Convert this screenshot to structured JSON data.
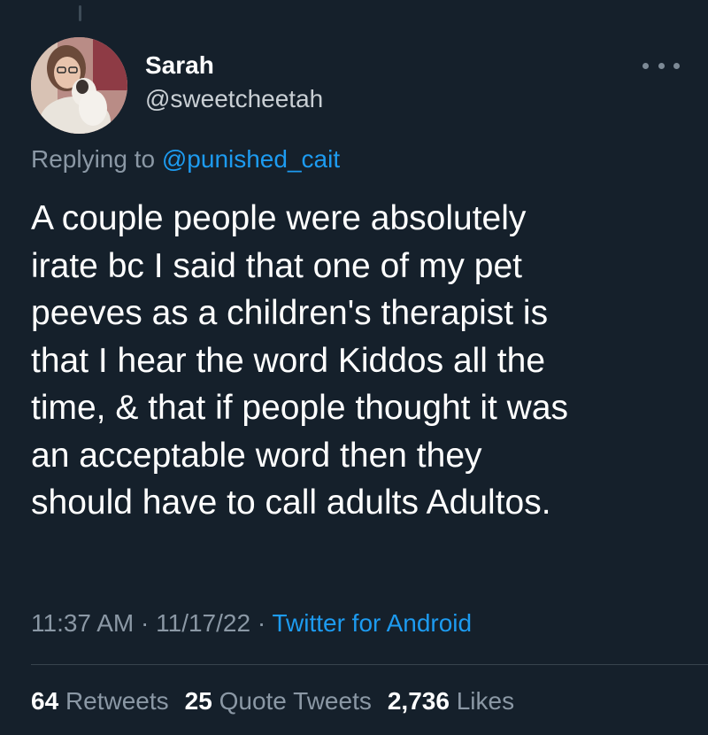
{
  "author": {
    "display_name": "Sarah",
    "handle": "@sweetcheetah"
  },
  "reply": {
    "prefix": "Replying to",
    "mention": "@punished_cait"
  },
  "tweet": {
    "lines": [
      "A couple people were absolutely",
      "irate bc I said that one of my pet",
      "peeves as a children's therapist is",
      "that I hear the word Kiddos all the",
      "time, & that if people thought it was",
      "an acceptable word then they",
      "should have to call adults Adultos."
    ]
  },
  "meta": {
    "time": "11:37 AM",
    "separator": "·",
    "date": "11/17/22",
    "source": "Twitter for Android"
  },
  "stats": {
    "retweets_count": "64",
    "retweets_label": "Retweets",
    "quotes_count": "25",
    "quotes_label": "Quote Tweets",
    "likes_count": "2,736",
    "likes_label": "Likes"
  },
  "icons": {
    "more": "more-horizontal-icon"
  },
  "colors": {
    "background": "#15202b",
    "link": "#1d9bf0",
    "secondary_text": "#8b98a5"
  }
}
